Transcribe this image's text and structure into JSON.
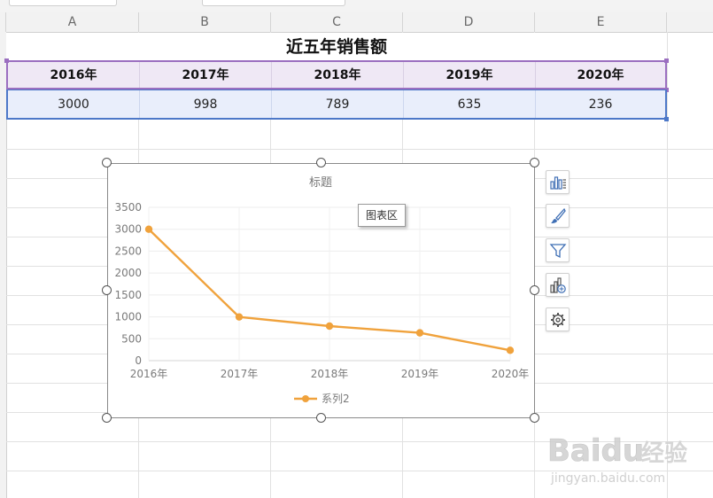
{
  "columns": [
    "A",
    "B",
    "C",
    "D",
    "E"
  ],
  "sheet_title": "近五年销售额",
  "table": {
    "years": [
      "2016年",
      "2017年",
      "2018年",
      "2019年",
      "2020年"
    ],
    "values": [
      "3000",
      "998",
      "789",
      "635",
      "236"
    ]
  },
  "chart_tooltip": "图表区",
  "side_toolbar": {
    "chart_elements_icon": "chart-elements-icon",
    "chart_style_icon": "brush-icon",
    "chart_filter_icon": "filter-icon",
    "chart_type_icon": "chart-type-icon",
    "settings_icon": "gear-icon"
  },
  "watermark": {
    "brand": "Baidu",
    "brand_suffix": "经验",
    "url": "jingyan.baidu.com"
  },
  "colors": {
    "series": "#f0a23c",
    "year_row_bg": "#efe8f5",
    "year_row_border": "#9b6fc0",
    "value_row_bg": "#e9eefb",
    "value_row_border": "#4d78c8"
  },
  "chart_data": {
    "type": "line",
    "title": "标题",
    "categories": [
      "2016年",
      "2017年",
      "2018年",
      "2019年",
      "2020年"
    ],
    "series": [
      {
        "name": "系列2",
        "values": [
          3000,
          998,
          789,
          635,
          236
        ]
      }
    ],
    "y_ticks": [
      "0",
      "500",
      "1000",
      "1500",
      "2000",
      "2500",
      "3000",
      "3500"
    ],
    "ylim": [
      0,
      3500
    ],
    "grid": true,
    "legend": "bottom"
  }
}
